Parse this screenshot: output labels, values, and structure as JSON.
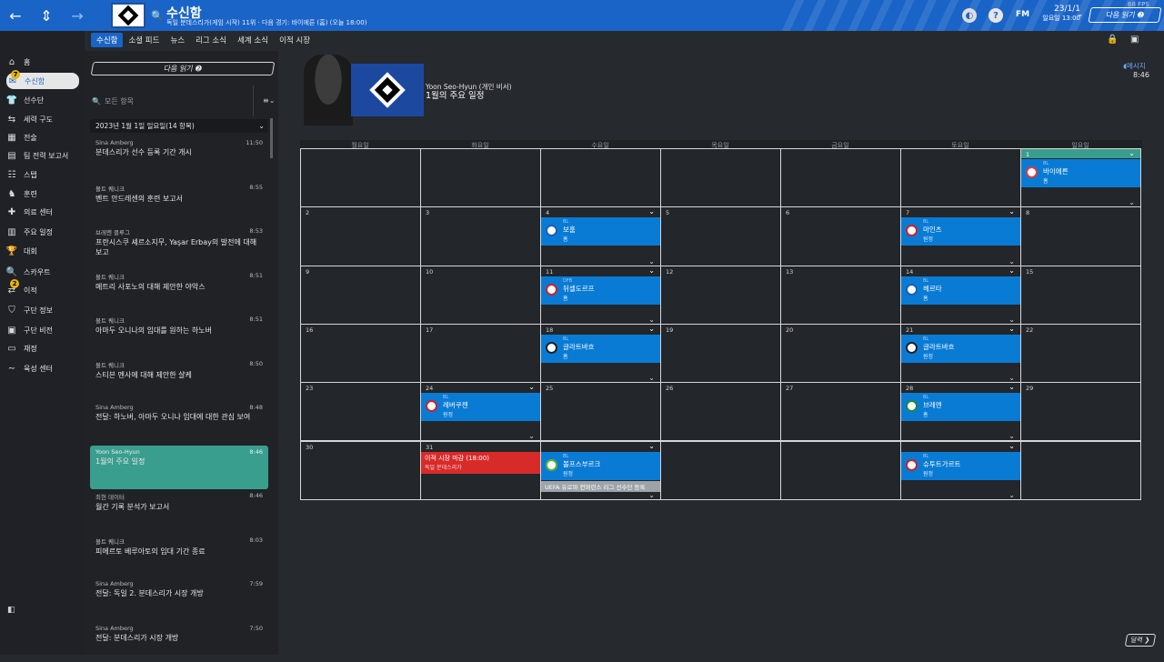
{
  "header": {
    "title": "수신함",
    "subtitle": "독일 분데스리가(게임 시작) 11위 · 다음 경기: 바이에른 (홈) (오늘 18:00)",
    "date_line1": "23/1/1",
    "date_line2": "일요일 13:00",
    "next_label": "다음 읽기 ➋",
    "fm_label": "FM",
    "fps": "68 FPS"
  },
  "sidebar": {
    "items": [
      {
        "label": "홈",
        "icon": "home-icon"
      },
      {
        "label": "수신함",
        "icon": "inbox-icon",
        "badge": "7"
      },
      {
        "label": "선수단",
        "icon": "shirt-icon"
      },
      {
        "label": "세력 구도",
        "icon": "dynamics-icon"
      },
      {
        "label": "전술",
        "icon": "tactics-icon"
      },
      {
        "label": "팀 전력 보고서",
        "icon": "report-icon"
      },
      {
        "label": "스탭",
        "icon": "staff-icon"
      },
      {
        "label": "훈련",
        "icon": "training-icon"
      },
      {
        "label": "의료 센터",
        "icon": "medical-icon"
      },
      {
        "label": "주요 일정",
        "icon": "calendar-icon"
      },
      {
        "label": "대회",
        "icon": "trophy-icon"
      },
      {
        "label": "스카우트",
        "icon": "scout-icon"
      },
      {
        "label": "이적",
        "icon": "transfer-icon",
        "badge": "2"
      },
      {
        "label": "구단 정보",
        "icon": "club-info-icon"
      },
      {
        "label": "구단 비전",
        "icon": "club-vision-icon"
      },
      {
        "label": "재정",
        "icon": "finance-icon"
      },
      {
        "label": "육성 센터",
        "icon": "development-icon"
      }
    ]
  },
  "subtabs": [
    "수신함",
    "소셜 피드",
    "뉴스",
    "리그 소식",
    "세계 소식",
    "이적 시장"
  ],
  "inbox": {
    "next_read": "다음 읽기 ➋",
    "search_placeholder": "모든 항목",
    "group": "2023년 1월 1일 일요일(14 항목)",
    "messages": [
      {
        "sender": "Sina Amberg",
        "time": "11:50",
        "subject": "분데스리가 선수 등록 기간 개시"
      },
      {
        "sender": "볼트 퀘니크",
        "time": "8:55",
        "subject": "벤트 안드레센의 훈련 보고서"
      },
      {
        "sender": "브레멘 클루그",
        "time": "8:53",
        "subject": "프란시스쿠 셰르소지무, Yaşar Erbay의 발전에 대해 보고"
      },
      {
        "sender": "볼트 퀘니크",
        "time": "8:51",
        "subject": "메트리 사포노의 대해 제안한 야악스"
      },
      {
        "sender": "볼트 퀘니크",
        "time": "8:51",
        "subject": "아마두 오니나의 임대를 원하는 하노버"
      },
      {
        "sender": "볼트 퀘니크",
        "time": "8:50",
        "subject": "스티븐 멘사에 대해 제안한 샬케"
      },
      {
        "sender": "Sina Amberg",
        "time": "8:48",
        "subject": "전달: 하노버, 아마두 오니나 임대에 대한 관심 보여"
      },
      {
        "sender": "Yoon Seo-Hyun",
        "time": "8:46",
        "subject": "1월의 주요 일정"
      },
      {
        "sender": "최현 데이터",
        "time": "8:46",
        "subject": "월간 기록 분석가 보고서"
      },
      {
        "sender": "볼트 퀘니크",
        "time": "8:03",
        "subject": "피에르토 베루아토의 임대 기간 종료"
      },
      {
        "sender": "Sina Amberg",
        "time": "7:59",
        "subject": "전달: 독일 2. 분데스리가 시장 개방"
      },
      {
        "sender": "Sina Amberg",
        "time": "7:50",
        "subject": "전달: 분데스리가 시장 개방"
      }
    ]
  },
  "mail": {
    "from": "Yoon Seo-Hyun  (개인 비서)",
    "subject": "1월의 주요 일정",
    "link": "◖메시지",
    "time": "8:46"
  },
  "calendar": {
    "days": [
      "월요일",
      "화요일",
      "수요일",
      "목요일",
      "금요일",
      "토요일",
      "일요일"
    ],
    "cells": [
      [
        "",
        "",
        "",
        "",
        "",
        "",
        "1"
      ],
      [
        "2",
        "3",
        "4",
        "5",
        "6",
        "7",
        "8"
      ],
      [
        "9",
        "10",
        "11",
        "12",
        "13",
        "14",
        "15"
      ],
      [
        "16",
        "17",
        "18",
        "19",
        "20",
        "21",
        "22"
      ],
      [
        "23",
        "24",
        "25",
        "26",
        "27",
        "28",
        "29"
      ],
      [
        "30",
        "31",
        "",
        "",
        "",
        "",
        ""
      ]
    ],
    "events": [
      {
        "row": 0,
        "col": 6,
        "comp": "BL",
        "name": "바이에른",
        "venue": "홈",
        "color": "#e03a3a"
      },
      {
        "row": 1,
        "col": 2,
        "comp": "BL",
        "name": "보훔",
        "venue": "홈",
        "color": "#1a5fb4"
      },
      {
        "row": 1,
        "col": 5,
        "comp": "BL",
        "name": "마인츠",
        "venue": "원정",
        "color": "#d41f1f"
      },
      {
        "row": 2,
        "col": 2,
        "comp": "DFB",
        "name": "뒤셀도르프",
        "venue": "홈",
        "color": "#d41f1f"
      },
      {
        "row": 2,
        "col": 5,
        "comp": "BL",
        "name": "헤르타",
        "venue": "홈",
        "color": "#1a5fb4"
      },
      {
        "row": 3,
        "col": 2,
        "comp": "BL",
        "name": "글라트바흐",
        "venue": "홈",
        "color": "#222"
      },
      {
        "row": 3,
        "col": 5,
        "comp": "BL",
        "name": "글라트바흐",
        "venue": "원정",
        "color": "#222"
      },
      {
        "row": 4,
        "col": 1,
        "comp": "BL",
        "name": "레버쿠젠",
        "venue": "원정",
        "color": "#d41f1f"
      },
      {
        "row": 4,
        "col": 5,
        "comp": "BL",
        "name": "브레멘",
        "venue": "홈",
        "color": "#1d8a3a"
      },
      {
        "row": 5,
        "col": 2,
        "comp": "BL",
        "name": "볼프스부르크",
        "venue": "원정",
        "color": "#5fb32e"
      },
      {
        "row": 5,
        "col": 5,
        "comp": "BL",
        "name": "슈투트가르트",
        "venue": "원정",
        "color": "#d41f1f"
      }
    ],
    "deadline": {
      "title": "이적 시장 마감 (18:00)",
      "sub": "독일 분데스리가"
    },
    "uefa": "UEFA 유로파 컨퍼런스 리그 선수단 등록"
  },
  "bottom_button": "달력 ❯",
  "colors": {
    "accent": "#1a64c8",
    "event": "#0a7bd4",
    "active_msg": "#3a9e8f",
    "deadline": "#d92a2a"
  }
}
